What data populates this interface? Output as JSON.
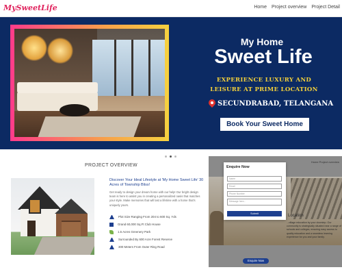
{
  "header": {
    "logo": "MySweetLife",
    "nav": [
      "Home",
      "Project overview",
      "Project Detail"
    ]
  },
  "hero": {
    "subtitle": "My Home",
    "title": "Sweet Life",
    "tagline": "EXPERIENCE LUXURY AND LEISURE AT PRIME LOCATION",
    "location": "SECUNDRABAD, TELANGANA",
    "cta": "Book Your Sweet Home",
    "slide_count": 3,
    "active_slide": 2
  },
  "overview": {
    "heading": "PROJECT OVERVIEW",
    "title": "Discover Your Ideal Lifestyle at 'My Home Sweet Life' 30 Acres of Township Bliss!",
    "body": "Get ready to design your dream home with our help! Our bright design team is here to assist you in creating a personalized oasis that matches your style. Make memories that will last a lifetime with a home that's uniquely yours.",
    "features": [
      {
        "icon": "triangle-icon",
        "text": "Plot Size Ranging From 204 to 600 Sq. Yds"
      },
      {
        "icon": "clubhouse-icon",
        "text": "Grand 60,000 Sq.Ft Club House"
      },
      {
        "icon": "park-icon",
        "text": "1.5 Acres Greenery Park"
      },
      {
        "icon": "forest-icon",
        "text": "Surrounded By 600 Acre Forest Reserve"
      },
      {
        "icon": "road-icon",
        "text": "300 Meters From Outer Ring Road"
      }
    ]
  },
  "background_page": {
    "breadcrumb": "Home  Project overview",
    "location_heading": "Location",
    "location_text": "...village education by your doorstep. Our community is strategically situated near a range of schools and colleges, ensuring easy access to quality education and a seamless learning experience for you and your family.",
    "enquire_button": "Enquire Now"
  },
  "enquire_modal": {
    "title": "Enquire Now",
    "name_placeholder": "Name",
    "email_placeholder": "Email",
    "phone_placeholder": "Phone Number",
    "message_placeholder": "Message here...",
    "submit": "Submit"
  },
  "colors": {
    "brand": "#e0245e",
    "hero_bg": "#0c2a63",
    "accent_gold": "#f2cf3a",
    "primary_blue": "#1d3f8f"
  }
}
